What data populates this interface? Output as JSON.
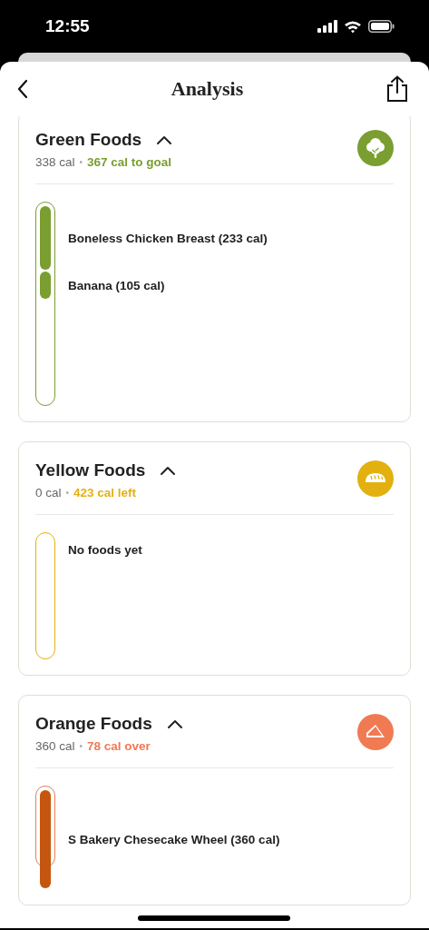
{
  "status_bar": {
    "time": "12:55"
  },
  "header": {
    "title": "Analysis"
  },
  "categories": [
    {
      "name": "Green Foods",
      "expanded": true,
      "calories": "338 cal",
      "separator": "•",
      "remaining": "367 cal to goal",
      "color": "#7a9e2f",
      "foods": [
        {
          "label": "Boneless Chicken Breast (233 cal)"
        },
        {
          "label": "Banana (105 cal)"
        }
      ]
    },
    {
      "name": "Yellow Foods",
      "expanded": true,
      "calories": "0 cal",
      "separator": "•",
      "remaining": "423 cal left",
      "color": "#e3b10f",
      "empty_text": "No foods yet"
    },
    {
      "name": "Orange Foods",
      "expanded": true,
      "calories": "360 cal",
      "separator": "•",
      "remaining": "78 cal over",
      "color": "#f07a52",
      "foods": [
        {
          "label": "S Bakery Chesecake Wheel (360 cal)"
        }
      ]
    }
  ]
}
